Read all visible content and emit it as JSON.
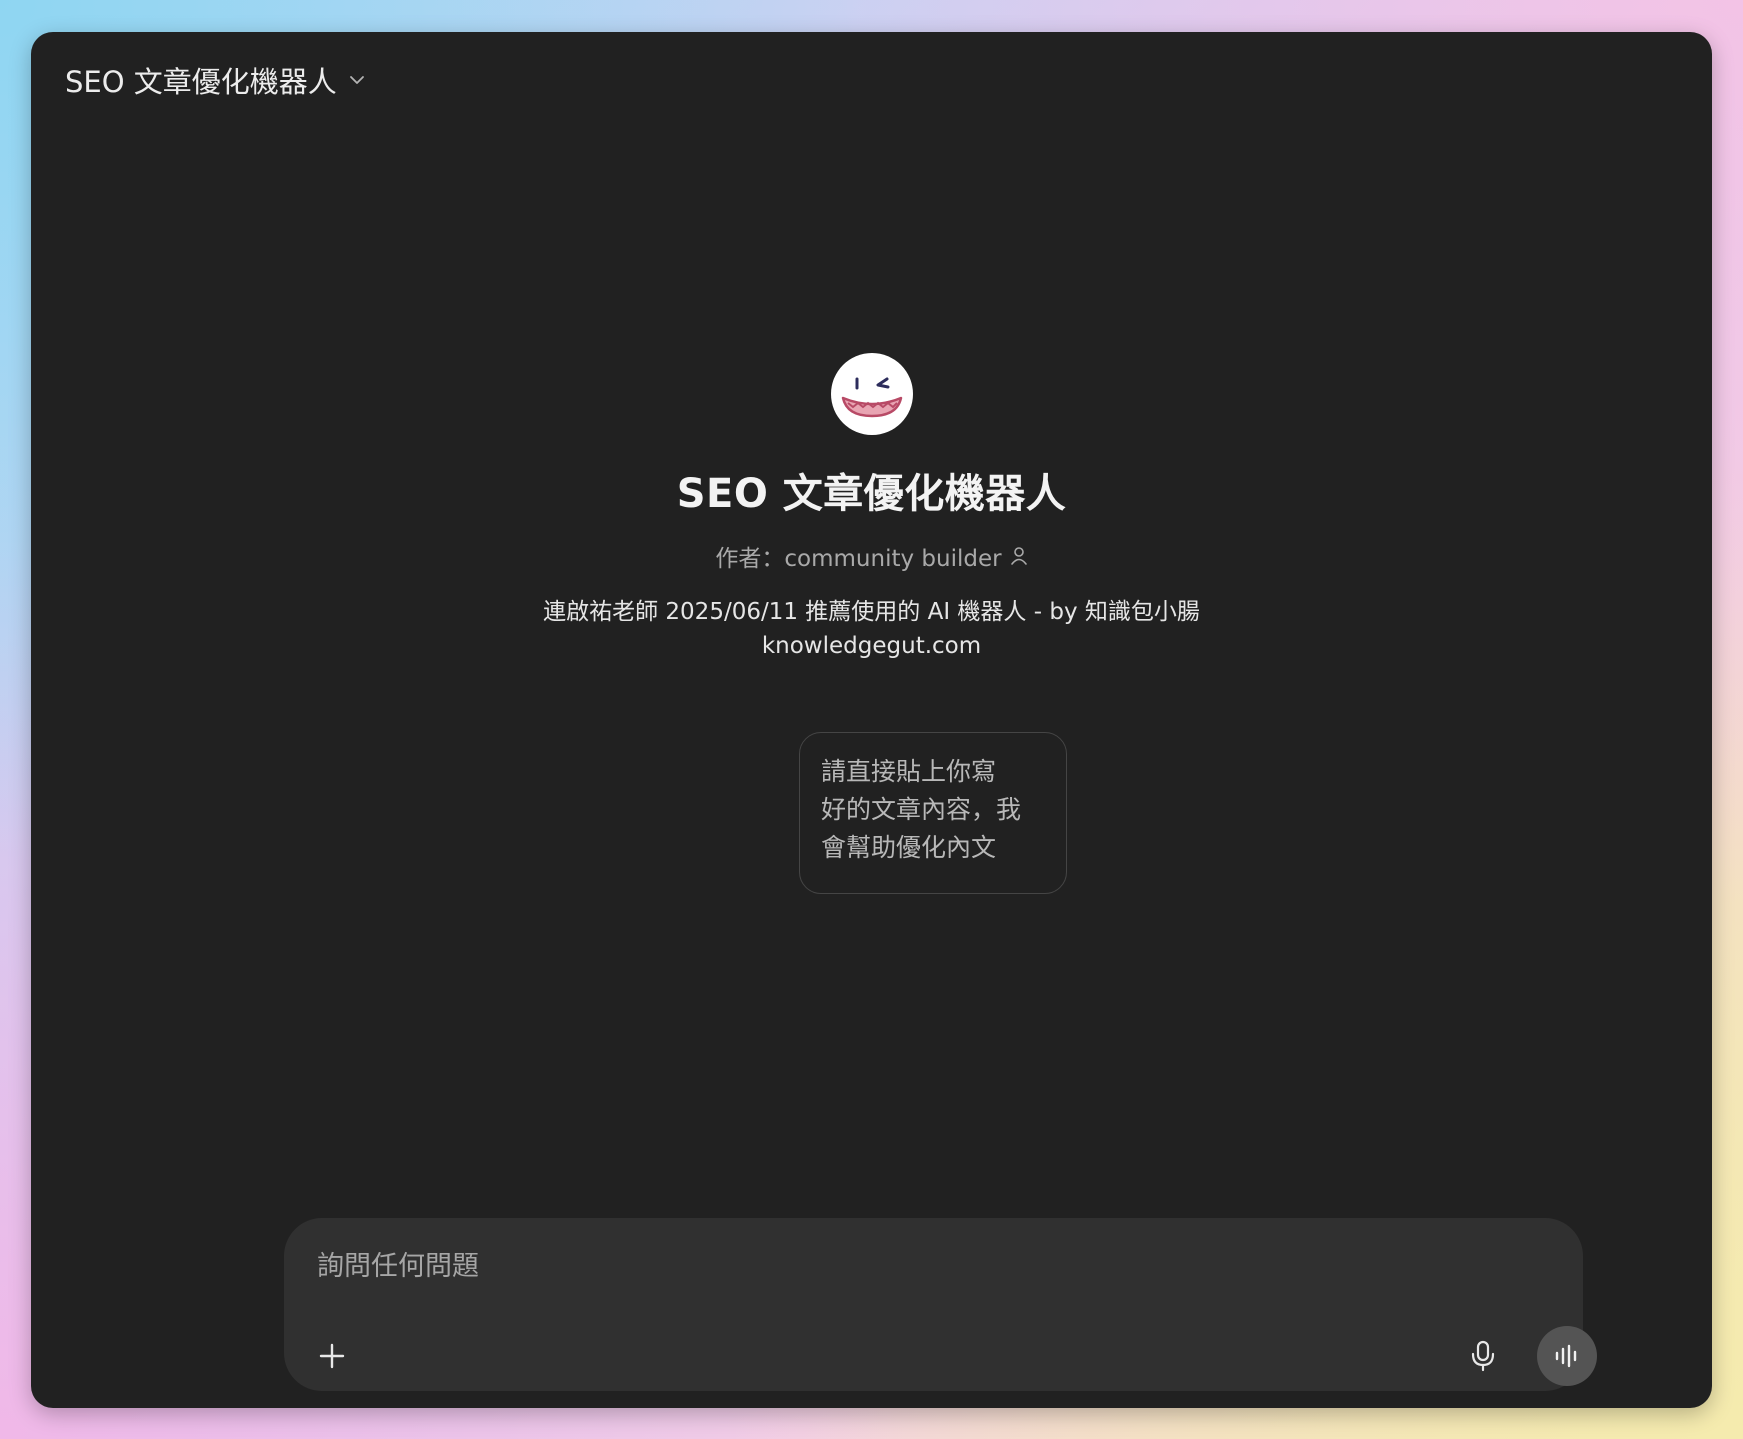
{
  "header": {
    "gpt_name": "SEO 文章優化機器人",
    "dropdown_icon": "chevron-down-icon"
  },
  "intro": {
    "avatar_icon": "smiling-face-icon",
    "title": "SEO 文章優化機器人",
    "author_text": "作者：community builder",
    "author_icon": "person-icon",
    "description_line1": "連啟祐老師 2025/06/11 推薦使用的 AI 機器人 - by 知識包小腸",
    "description_line2": "knowledgegut.com"
  },
  "conversation_starters": [
    {
      "line1": "請直接貼上你寫",
      "line2": "好的文章內容，我",
      "line3": "會幫助優化內文"
    }
  ],
  "composer": {
    "placeholder": "詢問任何問題",
    "value": "",
    "attach_icon": "plus-icon",
    "dictate_icon": "microphone-icon",
    "voice_icon": "voice-mode-icon"
  },
  "colors": {
    "window_bg": "#212121",
    "composer_bg": "#303030",
    "voice_button_bg": "#545454",
    "primary_text": "#ececec",
    "secondary_text": "#a9a9a9"
  }
}
